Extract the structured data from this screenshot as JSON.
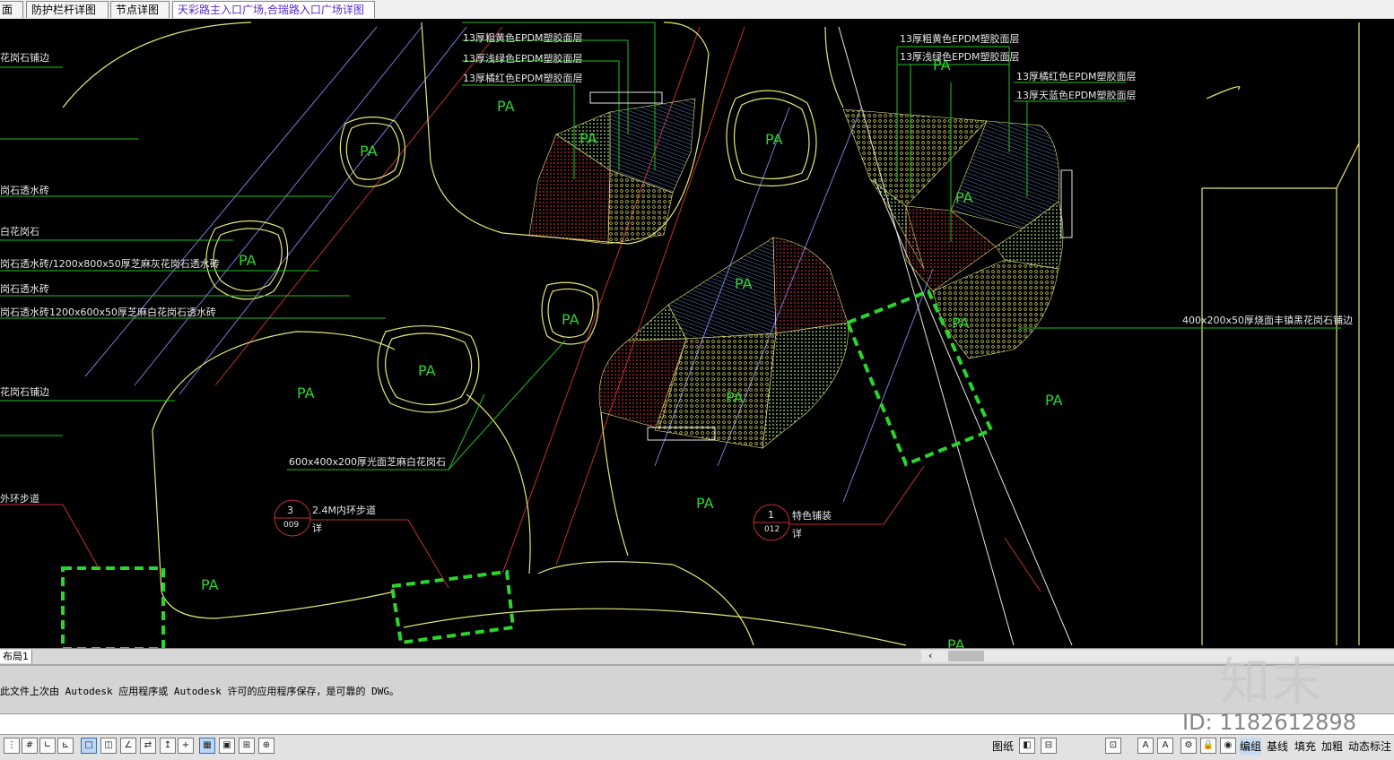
{
  "tabs": [
    "面图",
    "防护栏杆详图",
    "节点详图",
    "天彩路主入口广场,合瑞路入口广场详图"
  ],
  "drawing": {
    "pa": "PA",
    "top_left_labels": [
      "13厚粗黄色EPDM塑胶面层",
      "13厚浅绿色EPDM塑胶面层",
      "13厚橘红色EPDM塑胶面层"
    ],
    "top_right_labels": [
      "13厚粗黄色EPDM塑胶面层",
      "13厚浅绿色EPDM塑胶面层",
      "13厚橘红色EPDM塑胶面层",
      "13厚天蓝色EPDM塑胶面层"
    ],
    "left_labels": [
      "花岗石铺边",
      "岗石透水砖",
      "白花岗石",
      "岗石透水砖/1200x800x50厚芝麻灰花岗石透水砖",
      "岗石透水砖",
      "岗石透水砖1200x600x50厚芝麻白花岗石透水砖",
      "花岗石铺边",
      "外环步道"
    ],
    "stone_label": "600x400x200厚光面芝麻白花岗石",
    "right_label": "400x200x50厚烧面丰镇黑花岗石铺边",
    "detail1": {
      "num": "3",
      "sheet": "009",
      "text": "2.4M内环步道",
      "sub": "详"
    },
    "detail2": {
      "num": "1",
      "sheet": "012",
      "text": "特色铺装",
      "sub": "详"
    },
    "colors": {
      "green": "#2bd52b",
      "yellow": "#e6e676",
      "red": "#c81e1e",
      "blue": "#5c7ebf",
      "lightgreen": "#a6e18a",
      "label": "#e6e6e6"
    }
  },
  "layout_tab": "布局1",
  "scroll_arrow": "‹",
  "command_text": "此文件上次由 Autodesk 应用程序或 Autodesk 许可的应用程序保存，是可靠的 DWG。",
  "status": {
    "paper": "图纸",
    "edit": "编组",
    "baseline": "基线",
    "fill": "填充",
    "bold": "加粗",
    "dyn": "动态标注"
  },
  "watermark": {
    "logo": "知末",
    "id": "ID: 1182612898"
  }
}
